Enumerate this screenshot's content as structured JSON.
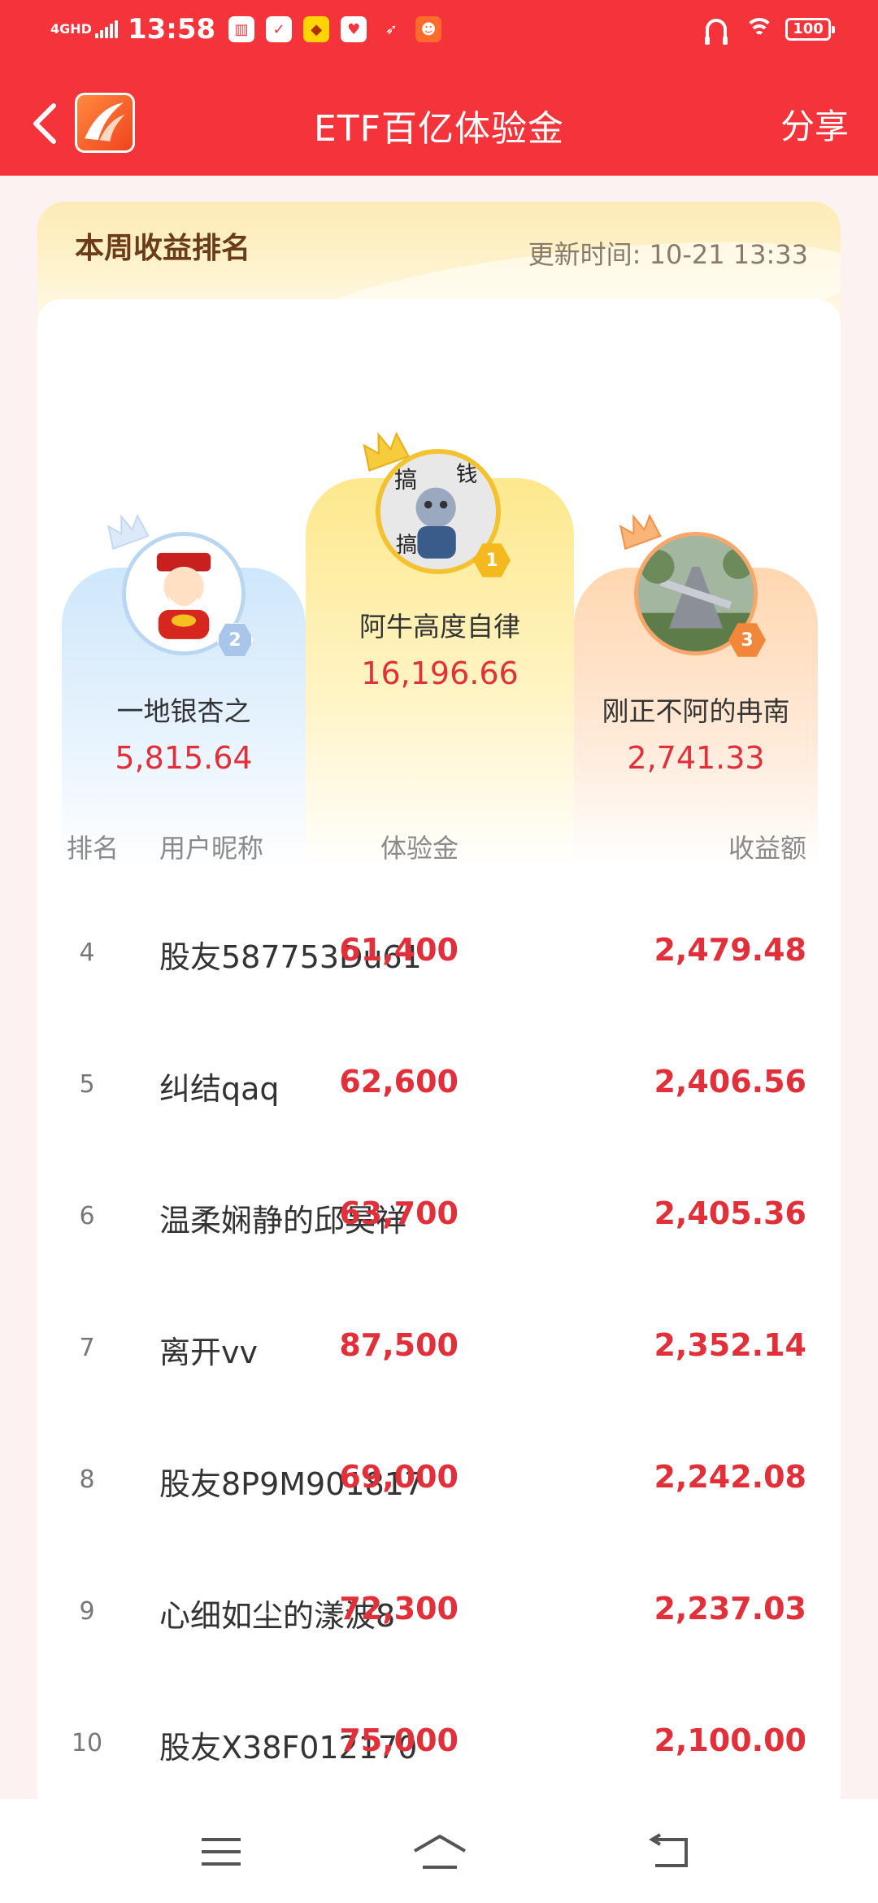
{
  "status_bar": {
    "network": "4GHD",
    "time": "13:58",
    "battery": "100",
    "app_icons": [
      "audio-icon",
      "clipboard-icon",
      "game-app-icon",
      "heart-app-icon",
      "bird-icon",
      "taobao-icon"
    ]
  },
  "header": {
    "title": "ETF百亿体验金",
    "share_label": "分享",
    "back_icon": "chevron-left-icon",
    "logo_icon": "app-logo-icon"
  },
  "leaderboard": {
    "title": "本周收益排名",
    "update_label": "更新时间:",
    "update_time": "10-21 13:33",
    "podium": [
      {
        "rank": "1",
        "name": "阿牛高度自律",
        "value": "16,196.66"
      },
      {
        "rank": "2",
        "name": "一地银杏之",
        "value": "5,815.64"
      },
      {
        "rank": "3",
        "name": "刚正不阿的冉南",
        "value": "2,741.33"
      }
    ],
    "columns": {
      "rank": "排名",
      "nickname": "用户昵称",
      "trial": "体验金",
      "earnings": "收益额"
    },
    "rows": [
      {
        "rank": "4",
        "nickname": "股友587753Du61",
        "trial": "61,400",
        "earnings": "2,479.48"
      },
      {
        "rank": "5",
        "nickname": "纠结qaq",
        "trial": "62,600",
        "earnings": "2,406.56"
      },
      {
        "rank": "6",
        "nickname": "温柔娴静的邱昊祥",
        "trial": "63,700",
        "earnings": "2,405.36"
      },
      {
        "rank": "7",
        "nickname": "离开vv",
        "trial": "87,500",
        "earnings": "2,352.14"
      },
      {
        "rank": "8",
        "nickname": "股友8P9M901817",
        "trial": "69,000",
        "earnings": "2,242.08"
      },
      {
        "rank": "9",
        "nickname": "心细如尘的漾波8",
        "trial": "72,300",
        "earnings": "2,237.03"
      },
      {
        "rank": "10",
        "nickname": "股友X38F012170",
        "trial": "75,000",
        "earnings": "2,100.00"
      }
    ]
  },
  "colors": {
    "brand_red": "#f5333b",
    "value_red": "#e1303a",
    "gold": "#f2c230",
    "silver": "#b9d6f3",
    "bronze": "#f7a76a"
  },
  "system_nav": {
    "icons": [
      "menu-icon",
      "home-icon",
      "back-icon"
    ]
  }
}
